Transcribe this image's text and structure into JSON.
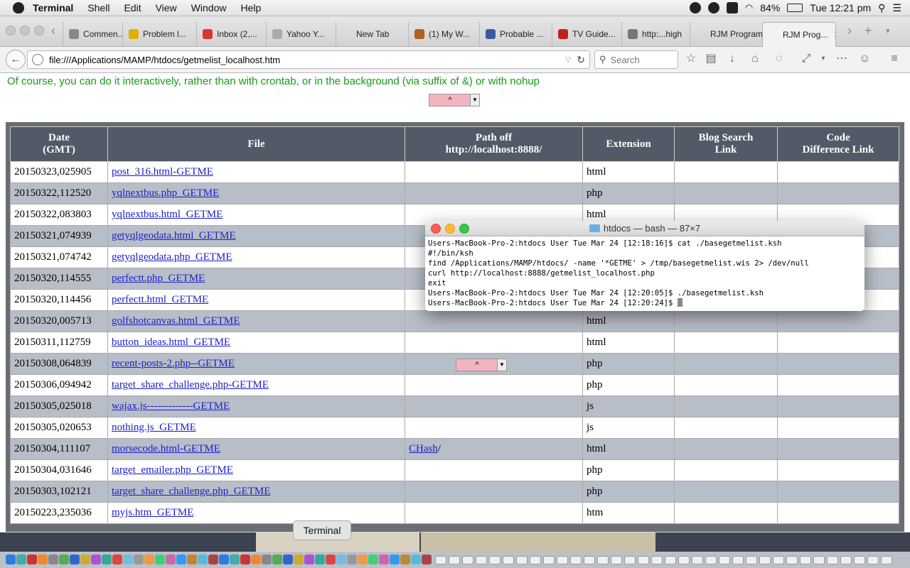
{
  "menubar": {
    "app": "Terminal",
    "items": [
      "Shell",
      "Edit",
      "View",
      "Window",
      "Help"
    ],
    "battery": "84%",
    "clock": "Tue 12:21 pm"
  },
  "tabs": [
    {
      "label": "Commen...",
      "color": "#888"
    },
    {
      "label": "Problem l...",
      "color": "#e0b000"
    },
    {
      "label": "Inbox (2,...",
      "color": "#d33"
    },
    {
      "label": "Yahoo Y...",
      "color": "#aaa"
    },
    {
      "label": "New Tab",
      "color": "transparent"
    },
    {
      "label": "(1) My W...",
      "color": "#b06020"
    },
    {
      "label": "Probable ...",
      "color": "#3a5aa0"
    },
    {
      "label": "TV Guide...",
      "color": "#c02020"
    },
    {
      "label": "http:...high",
      "color": "#777"
    },
    {
      "label": "RJM Program...",
      "color": "transparent"
    },
    {
      "label": "RJM Prog...",
      "color": "transparent"
    }
  ],
  "toolbar": {
    "url": "file:///Applications/MAMP/htdocs/getmelist_localhost.htm",
    "search_placeholder": "Search"
  },
  "page": {
    "intro": "Of course, you can do it interactively, rather than with crontab, or in the background (via suffix of &) or with nohup",
    "select_value": "^",
    "headers": [
      "Date\n(GMT)",
      "File",
      "Path off\nhttp://localhost:8888/",
      "Extension",
      "Blog Search\nLink",
      "Code\nDifference Link"
    ],
    "rows": [
      {
        "date": "20150323,025905",
        "file": "post_316.html-GETME",
        "path": "",
        "ext": "html"
      },
      {
        "date": "20150322,112520",
        "file": "yqlnextbus.php_GETME",
        "path": "",
        "ext": "php"
      },
      {
        "date": "20150322,083803",
        "file": "yqlnextbus.html_GETME",
        "path": "",
        "ext": "html"
      },
      {
        "date": "20150321,074939",
        "file": "getyqlgeodata.html_GETME",
        "path": "",
        "ext": ""
      },
      {
        "date": "20150321,074742",
        "file": "getyqlgeodata.php_GETME",
        "path": "",
        "ext": ""
      },
      {
        "date": "20150320,114555",
        "file": "perfectt.php_GETME",
        "path": "",
        "ext": ""
      },
      {
        "date": "20150320,114456",
        "file": "perfectt.html_GETME",
        "path": "",
        "ext": ""
      },
      {
        "date": "20150320,005713",
        "file": "golfshotcanvas.html_GETME",
        "path": "",
        "ext": "html"
      },
      {
        "date": "20150311,112759",
        "file": "button_ideas.html_GETME",
        "path": "",
        "ext": "html"
      },
      {
        "date": "20150308,064839",
        "file": "recent-posts-2.php--GETME",
        "path": "",
        "ext": "php"
      },
      {
        "date": "20150306,094942",
        "file": "target_share_challenge.php-GETME",
        "path": "",
        "ext": "php"
      },
      {
        "date": "20150305,025018",
        "file": "wajax.js-------------GETME",
        "path": "",
        "ext": "js"
      },
      {
        "date": "20150305,020653",
        "file": "nothing.js_GETME",
        "path": "",
        "ext": "js"
      },
      {
        "date": "20150304,111107",
        "file": "morsecode.html-GETME",
        "path": "CHash",
        "ext": "html"
      },
      {
        "date": "20150304,031646",
        "file": "target_emailer.php_GETME",
        "path": "",
        "ext": "php"
      },
      {
        "date": "20150303,102121",
        "file": "target_share_challenge.php_GETME",
        "path": "",
        "ext": "php"
      },
      {
        "date": "20150223,235036",
        "file": "myjs.htm_GETME",
        "path": "",
        "ext": "htm"
      }
    ]
  },
  "terminal": {
    "title": "htdocs — bash — 87×7",
    "lines": [
      "Users-MacBook-Pro-2:htdocs User Tue Mar 24 [12:18:16]$ cat ./basegetmelist.ksh",
      "#!/bin/ksh",
      "find /Applications/MAMP/htdocs/ -name '*GETME' > /tmp/basegetmelist.wis 2> /dev/null",
      "curl http://localhost:8888/getmelist_localhost.php",
      "exit",
      "Users-MacBook-Pro-2:htdocs User Tue Mar 24 [12:20:05]$ ./basegetmelist.ksh",
      "Users-MacBook-Pro-2:htdocs User Tue Mar 24 [12:20:24]$ "
    ]
  },
  "dock": {
    "tooltip": "Terminal"
  }
}
